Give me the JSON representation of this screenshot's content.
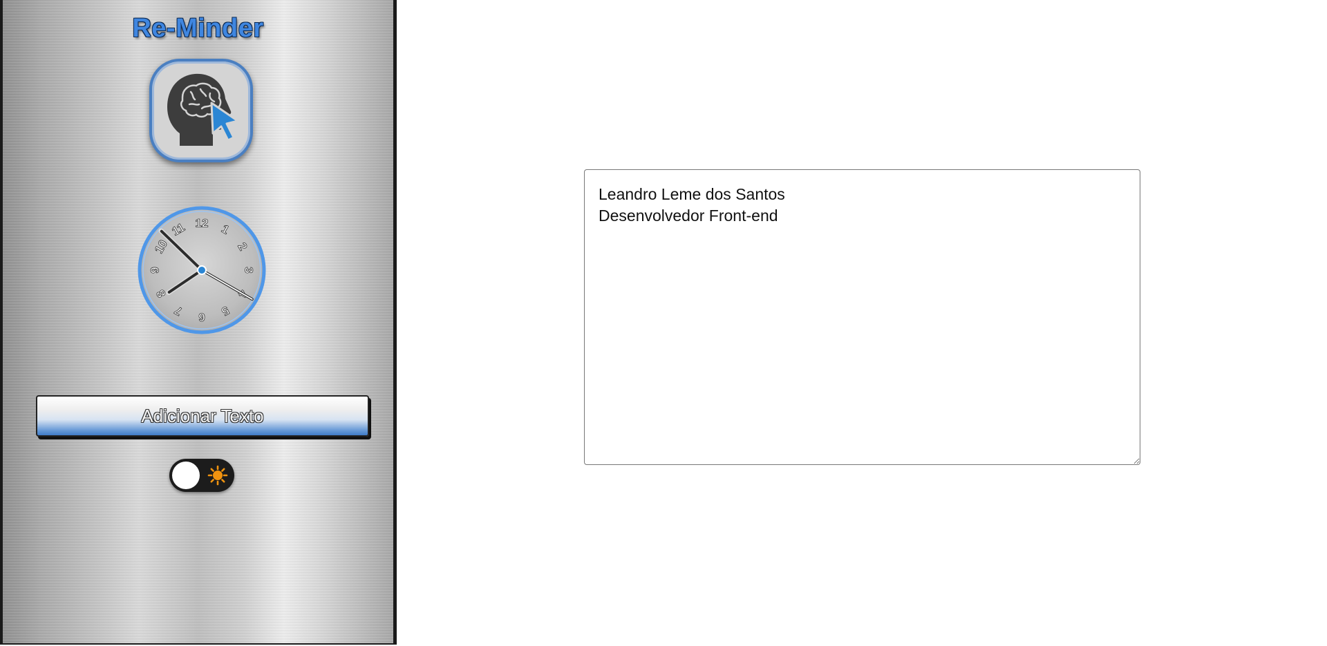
{
  "app": {
    "title": "Re-Minder"
  },
  "logo": {
    "icon": "brain-head-cursor-icon",
    "colors": {
      "head": "#3d3d3d",
      "cursor": "#2b86d4",
      "frame": "#4a7fc1"
    }
  },
  "clock": {
    "numbers": [
      "12",
      "1",
      "2",
      "3",
      "4",
      "5",
      "6",
      "7",
      "8",
      "9",
      "10",
      "11"
    ],
    "time": {
      "hour": 7,
      "minute": 52,
      "second": 20
    },
    "colors": {
      "ring": "#4f97e8",
      "center": "#2b86d4"
    }
  },
  "sidebar": {
    "add_button_label": "Adicionar Texto"
  },
  "theme_toggle": {
    "state": "light",
    "icon": "sun-icon",
    "icon_color": "#f0930f"
  },
  "note": {
    "text": "Leandro Leme dos Santos\nDesenvolvedor Front-end"
  }
}
